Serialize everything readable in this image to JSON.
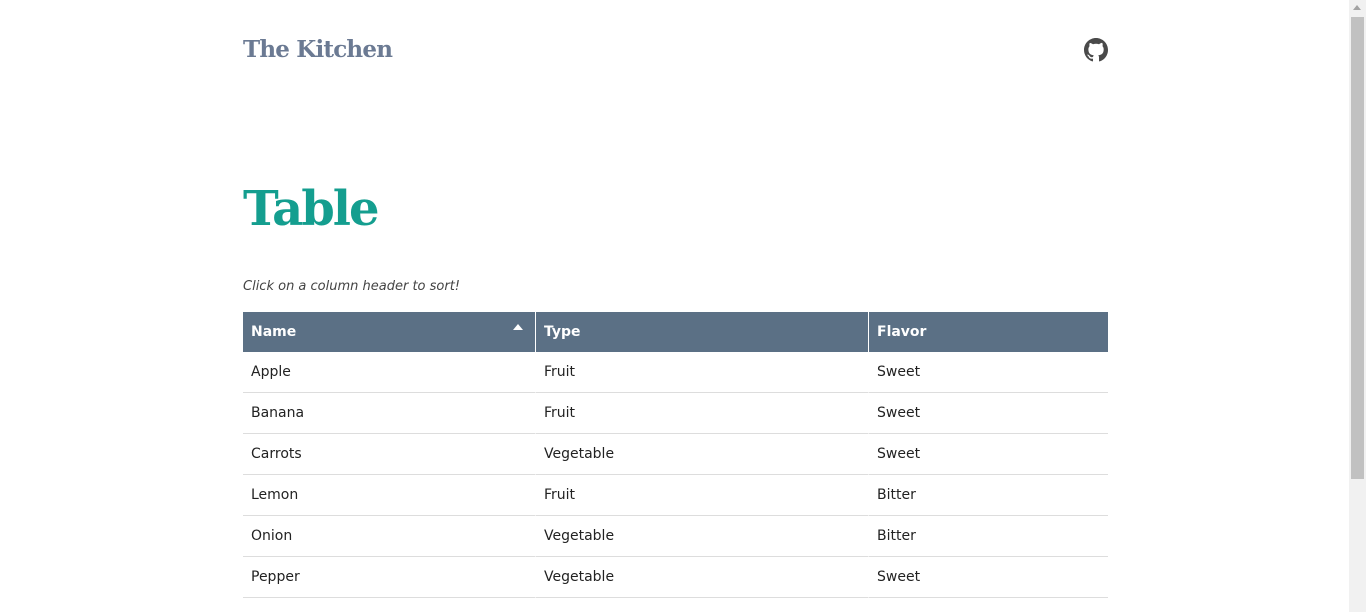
{
  "header": {
    "brand": "The Kitchen",
    "github_icon": "github-icon"
  },
  "main": {
    "title": "Table",
    "hint": "Click on a column header to sort!"
  },
  "table": {
    "sorted_by": "Name",
    "sort_direction": "ascending",
    "columns": [
      "Name",
      "Type",
      "Flavor"
    ],
    "rows": [
      [
        "Apple",
        "Fruit",
        "Sweet"
      ],
      [
        "Banana",
        "Fruit",
        "Sweet"
      ],
      [
        "Carrots",
        "Vegetable",
        "Sweet"
      ],
      [
        "Lemon",
        "Fruit",
        "Bitter"
      ],
      [
        "Onion",
        "Vegetable",
        "Bitter"
      ],
      [
        "Pepper",
        "Vegetable",
        "Sweet"
      ]
    ]
  },
  "colors": {
    "brand": "#6b7a93",
    "title": "#149e8f",
    "table_header_bg": "#5b7085"
  }
}
